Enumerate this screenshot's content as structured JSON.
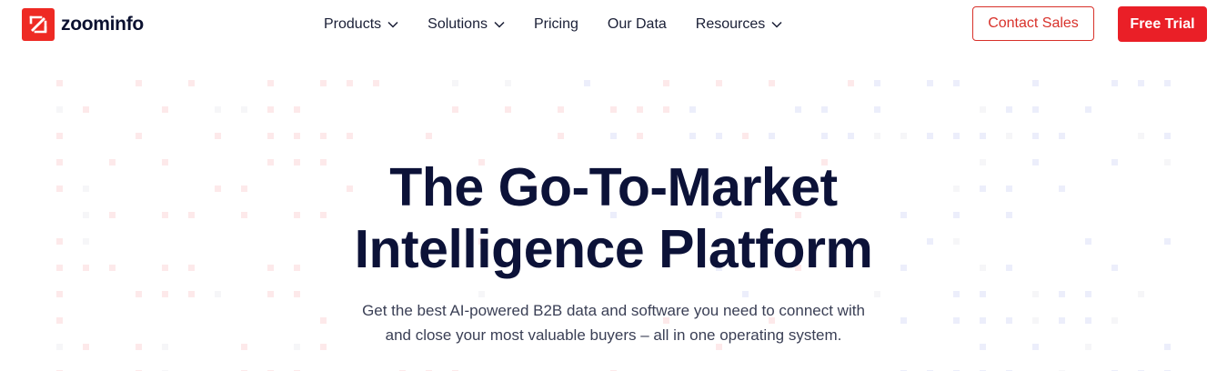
{
  "brand": {
    "name": "zoominfo",
    "accent_color": "#ee2a24"
  },
  "nav": {
    "items": [
      {
        "label": "Products",
        "has_dropdown": true
      },
      {
        "label": "Solutions",
        "has_dropdown": true
      },
      {
        "label": "Pricing",
        "has_dropdown": false
      },
      {
        "label": "Our Data",
        "has_dropdown": false
      },
      {
        "label": "Resources",
        "has_dropdown": true
      }
    ]
  },
  "actions": {
    "contact_label": "Contact Sales",
    "trial_label": "Free Trial"
  },
  "hero": {
    "title_line1": "The Go-To-Market",
    "title_line2": "Intelligence Platform",
    "subtitle_line1": "Get the best AI-powered B2B data and software you need to connect with",
    "subtitle_line2": "and close your most valuable buyers – all in one operating system."
  },
  "background": {
    "dot_colors": [
      "#fde9ea",
      "#eceefb",
      "#f6f6f8"
    ]
  }
}
